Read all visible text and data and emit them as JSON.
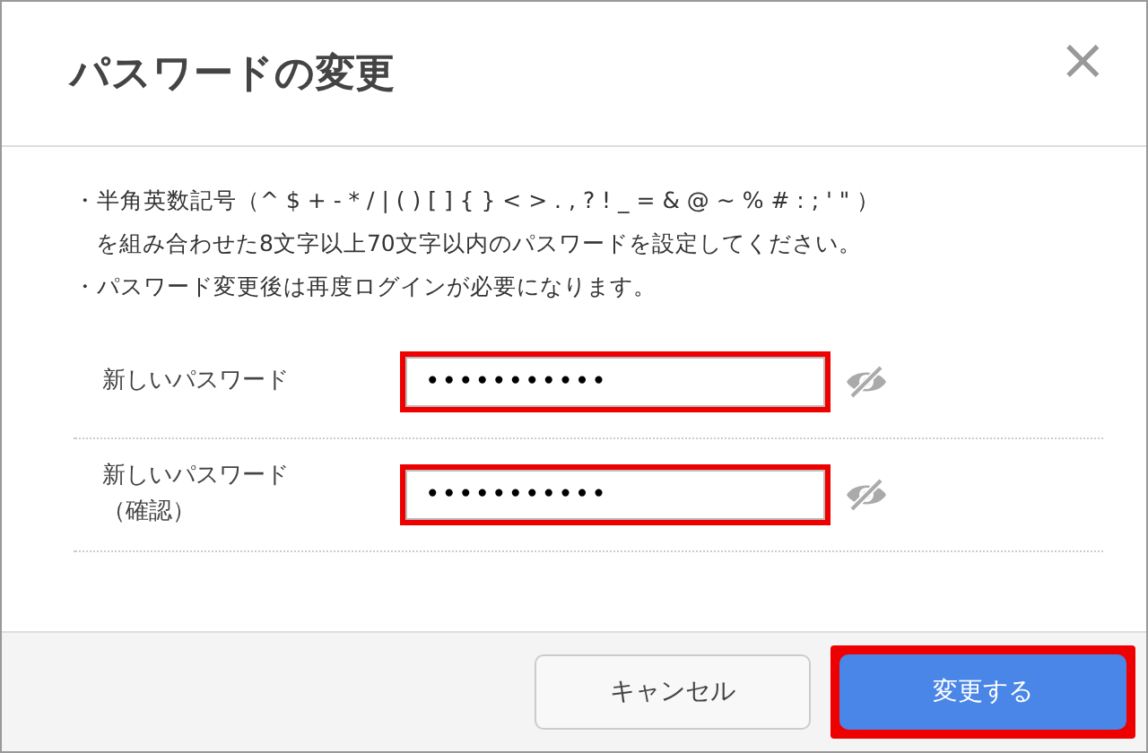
{
  "dialog": {
    "title": "パスワードの変更",
    "close": "×"
  },
  "notes": [
    {
      "lines": [
        "・半角英数記号（^ $ + - * / | ( ) [ ] { } < > . , ? ! _ = & @ ~ % # : ; ' \" ）",
        "を組み合わせた8文字以上70文字以内のパスワードを設定してください。"
      ]
    },
    {
      "lines": [
        "・パスワード変更後は再度ログインが必要になります。"
      ]
    }
  ],
  "fields": [
    {
      "label_lines": [
        "新しいパスワード"
      ],
      "value": "•••••••••••",
      "highlighted": true
    },
    {
      "label_lines": [
        "新しいパスワード",
        "（確認）"
      ],
      "value": "•••••••••••",
      "highlighted": true
    }
  ],
  "buttons": [
    {
      "label": "キャンセル",
      "kind": "secondary",
      "highlighted": false
    },
    {
      "label": "変更する",
      "kind": "primary",
      "highlighted": true
    }
  ]
}
